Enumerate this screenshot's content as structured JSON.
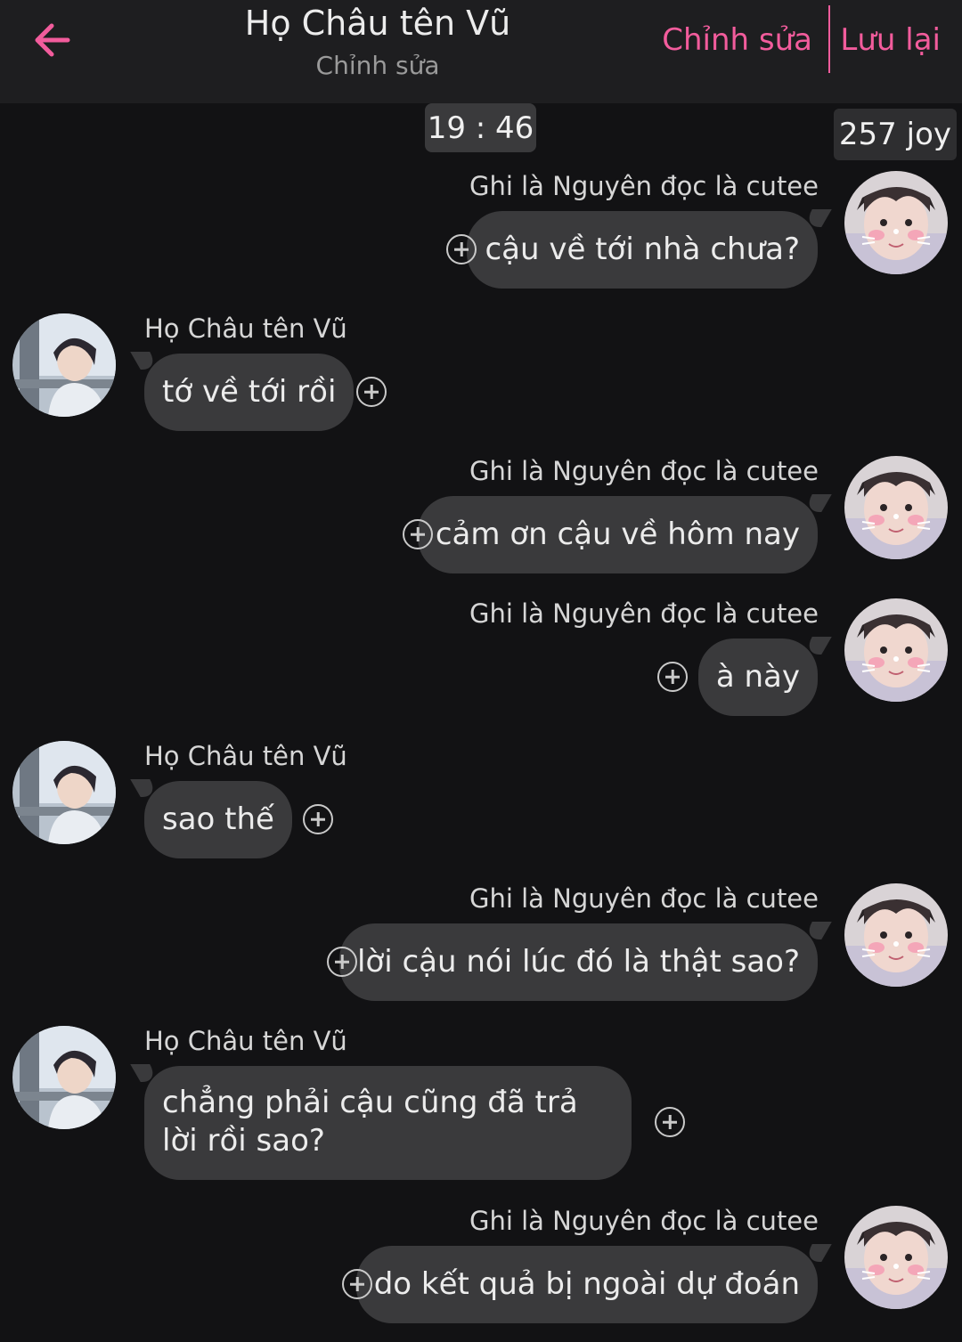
{
  "header": {
    "title": "Họ Châu tên Vũ",
    "subtitle": "Chỉnh sửa",
    "edit_label": "Chỉnh sửa",
    "save_label": "Lưu lại",
    "back_icon": "arrow-left-icon",
    "accent_color": "#f25c9c"
  },
  "time": "19 : 46",
  "joy": "257 joy",
  "messages": [
    {
      "side": "right",
      "sender": "Ghi là Nguyên đọc là cutee",
      "text": "cậu về tới nhà chưa?"
    },
    {
      "side": "left",
      "sender": "Họ Châu tên Vũ",
      "text": "tớ về tới rồi"
    },
    {
      "side": "right",
      "sender": "Ghi là Nguyên đọc là cutee",
      "text": "cảm ơn cậu về hôm nay"
    },
    {
      "side": "right",
      "sender": "Ghi là Nguyên đọc là cutee",
      "text": "à này"
    },
    {
      "side": "left",
      "sender": "Họ Châu tên Vũ",
      "text": "sao thế"
    },
    {
      "side": "right",
      "sender": "Ghi là Nguyên đọc là cutee",
      "text": "lời cậu nói lúc đó là thật sao?"
    },
    {
      "side": "left",
      "sender": "Họ Châu tên Vũ",
      "text": "chẳng phải cậu cũng đã trả lời rồi sao?"
    },
    {
      "side": "right",
      "sender": "Ghi là Nguyên đọc là cutee",
      "text": "do kết quả bị ngoài dự đoán"
    }
  ]
}
